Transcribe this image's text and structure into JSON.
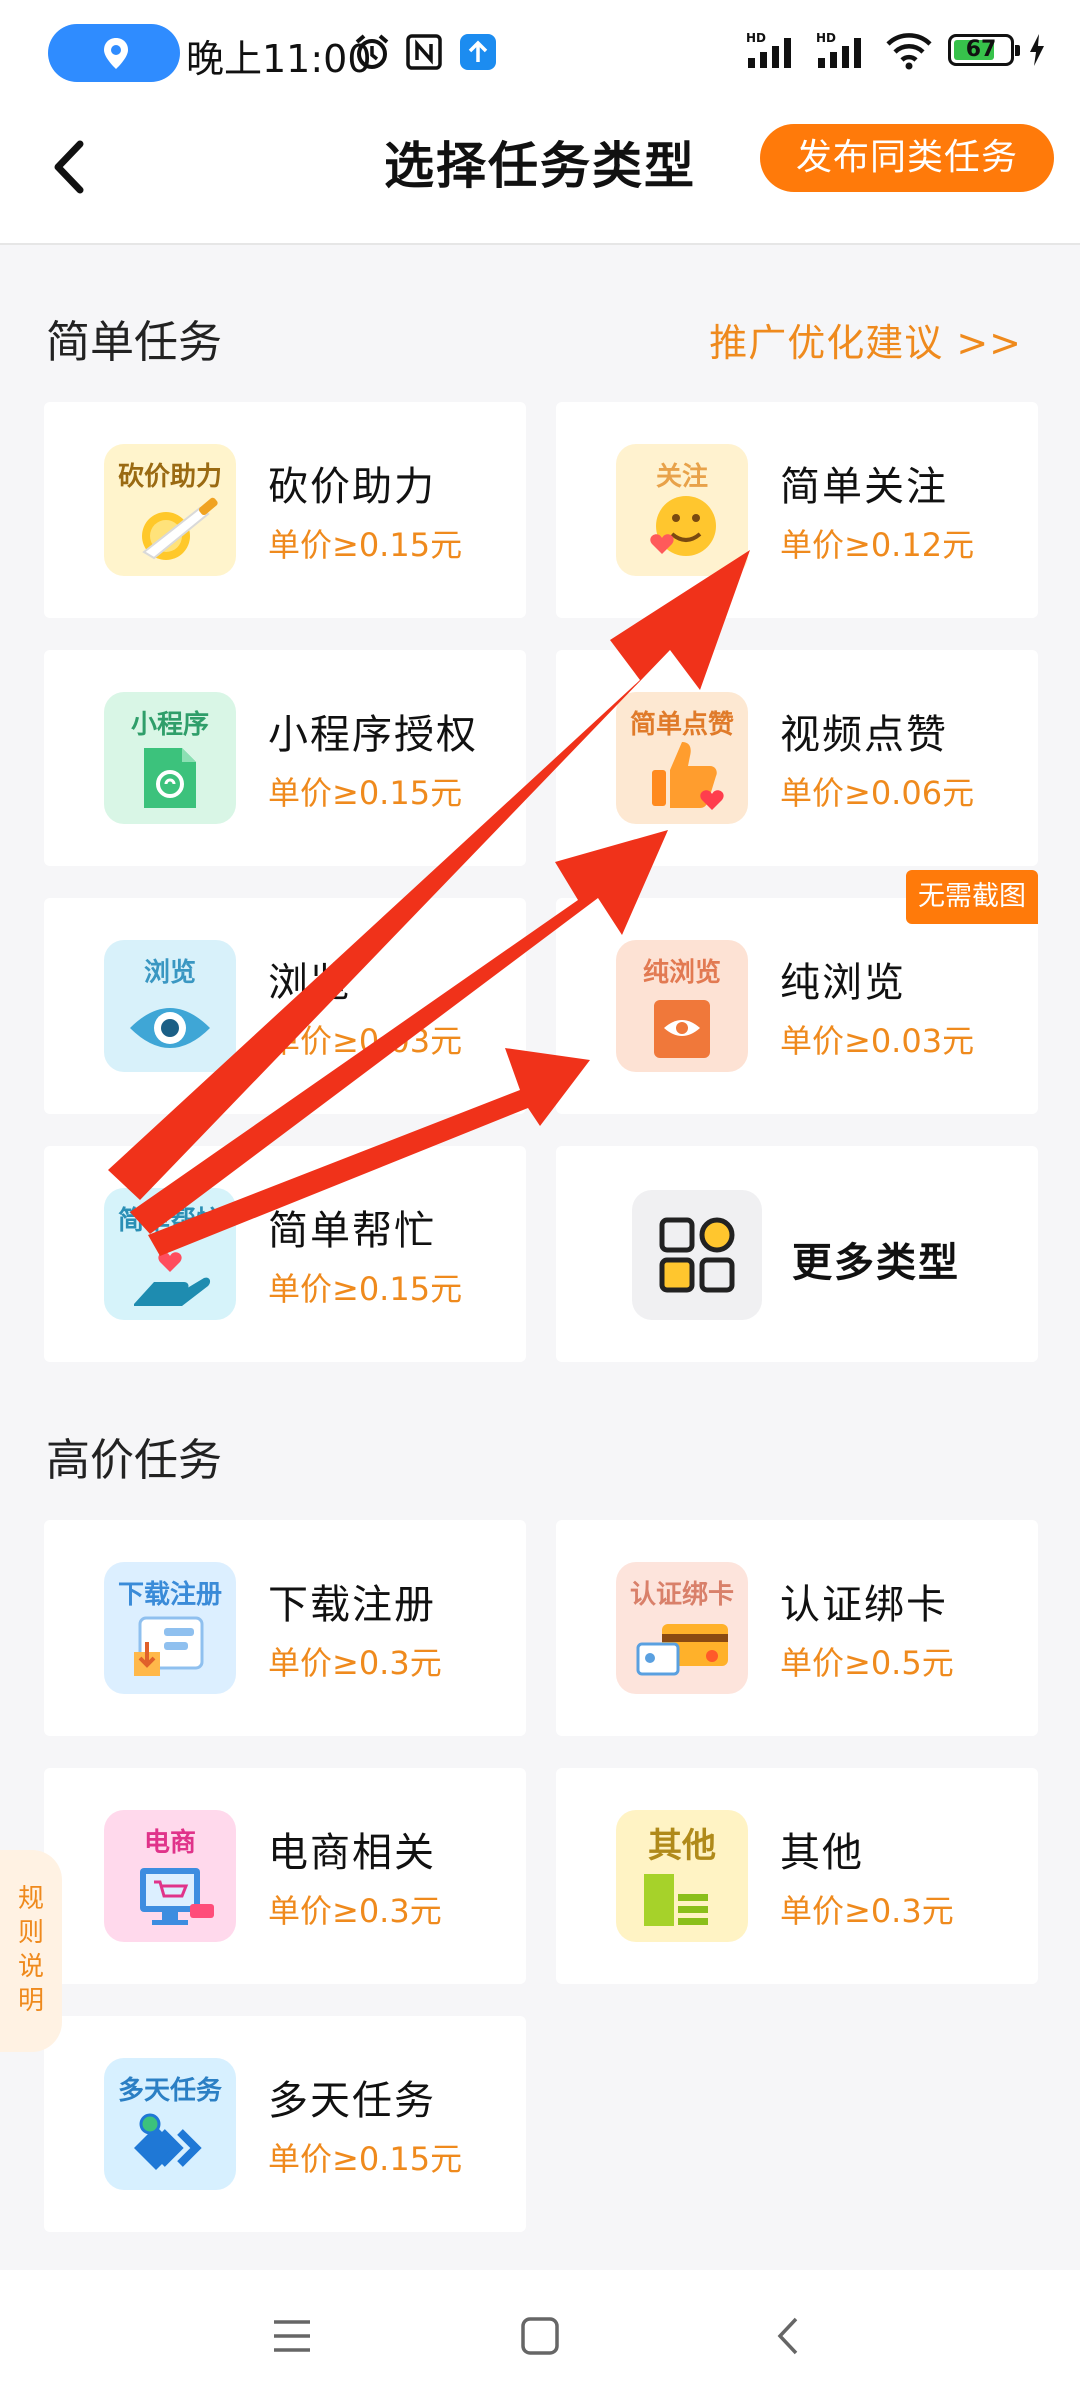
{
  "status_bar": {
    "time": "晚上11:00",
    "battery": "67",
    "icons": [
      "location-icon",
      "alarm-icon",
      "nfc-icon",
      "upload-icon",
      "signal-icon",
      "wifi-icon",
      "battery-icon",
      "charging-icon"
    ]
  },
  "header": {
    "title": "选择任务类型",
    "publish_button": "发布同类任务"
  },
  "simple_section": {
    "title": "简单任务",
    "link": "推广优化建议 >>",
    "tasks": [
      {
        "name": "砍价助力",
        "price": "单价≥0.15元",
        "icon_label": "砍价助力",
        "icon": "coin-knife-icon",
        "icon_bg": "#fff4cc",
        "label_color": "#9a6a12"
      },
      {
        "name": "简单关注",
        "price": "单价≥0.12元",
        "icon_label": "关注",
        "icon": "smile-face-icon",
        "icon_bg": "#fff2cf",
        "label_color": "#e8a24a"
      },
      {
        "name": "小程序授权",
        "price": "单价≥0.15元",
        "icon_label": "小程序",
        "icon": "mini-program-icon",
        "icon_bg": "#d9f6e6",
        "label_color": "#2f9e6a"
      },
      {
        "name": "视频点赞",
        "price": "单价≥0.06元",
        "icon_label": "简单点赞",
        "icon": "thumbs-up-icon",
        "icon_bg": "#fde8d2",
        "label_color": "#e07b2a"
      },
      {
        "name": "浏览",
        "price": "单价≥0.03元",
        "icon_label": "浏览",
        "icon": "eye-icon",
        "icon_bg": "#d8f1fa",
        "label_color": "#3a97c2"
      },
      {
        "name": "纯浏览",
        "price": "单价≥0.03元",
        "icon_label": "纯浏览",
        "icon": "eye-page-icon",
        "icon_bg": "#fde2d4",
        "label_color": "#e27a52",
        "badge": "无需截图"
      },
      {
        "name": "简单帮忙",
        "price": "单价≥0.15元",
        "icon_label": "简单帮忙",
        "icon": "helping-hand-icon",
        "icon_bg": "#d6f3fa",
        "label_color": "#2b8fb5"
      }
    ],
    "more": "更多类型"
  },
  "premium_section": {
    "title": "高价任务",
    "tasks": [
      {
        "name": "下载注册",
        "price": "单价≥0.3元",
        "icon_label": "下载注册",
        "icon": "download-register-icon",
        "icon_bg": "#dcefff",
        "label_color": "#3a8bd8"
      },
      {
        "name": "认证绑卡",
        "price": "单价≥0.5元",
        "icon_label": "认证绑卡",
        "icon": "bank-card-icon",
        "icon_bg": "#fde4dc",
        "label_color": "#d9806a"
      },
      {
        "name": "电商相关",
        "price": "单价≥0.3元",
        "icon_label": "电商",
        "icon": "shopping-cart-icon",
        "icon_bg": "#ffd9ec",
        "label_color": "#e0338a"
      },
      {
        "name": "其他",
        "price": "单价≥0.3元",
        "icon_label": "其他",
        "icon": "other-list-icon",
        "icon_bg": "#fff3c4",
        "label_color": "#b08a1a"
      },
      {
        "name": "多天任务",
        "price": "单价≥0.15元",
        "icon_label": "多天任务",
        "icon": "multi-day-icon",
        "icon_bg": "#d7f0ff",
        "label_color": "#2b7fc4"
      }
    ]
  },
  "rules_tab": "规则说明",
  "nav_bar": {
    "items": [
      "menu-icon",
      "home-icon",
      "back-icon"
    ]
  },
  "colors": {
    "accent": "#ff7a0a",
    "price": "#ef8a1d",
    "arrow": "#f0321a"
  }
}
